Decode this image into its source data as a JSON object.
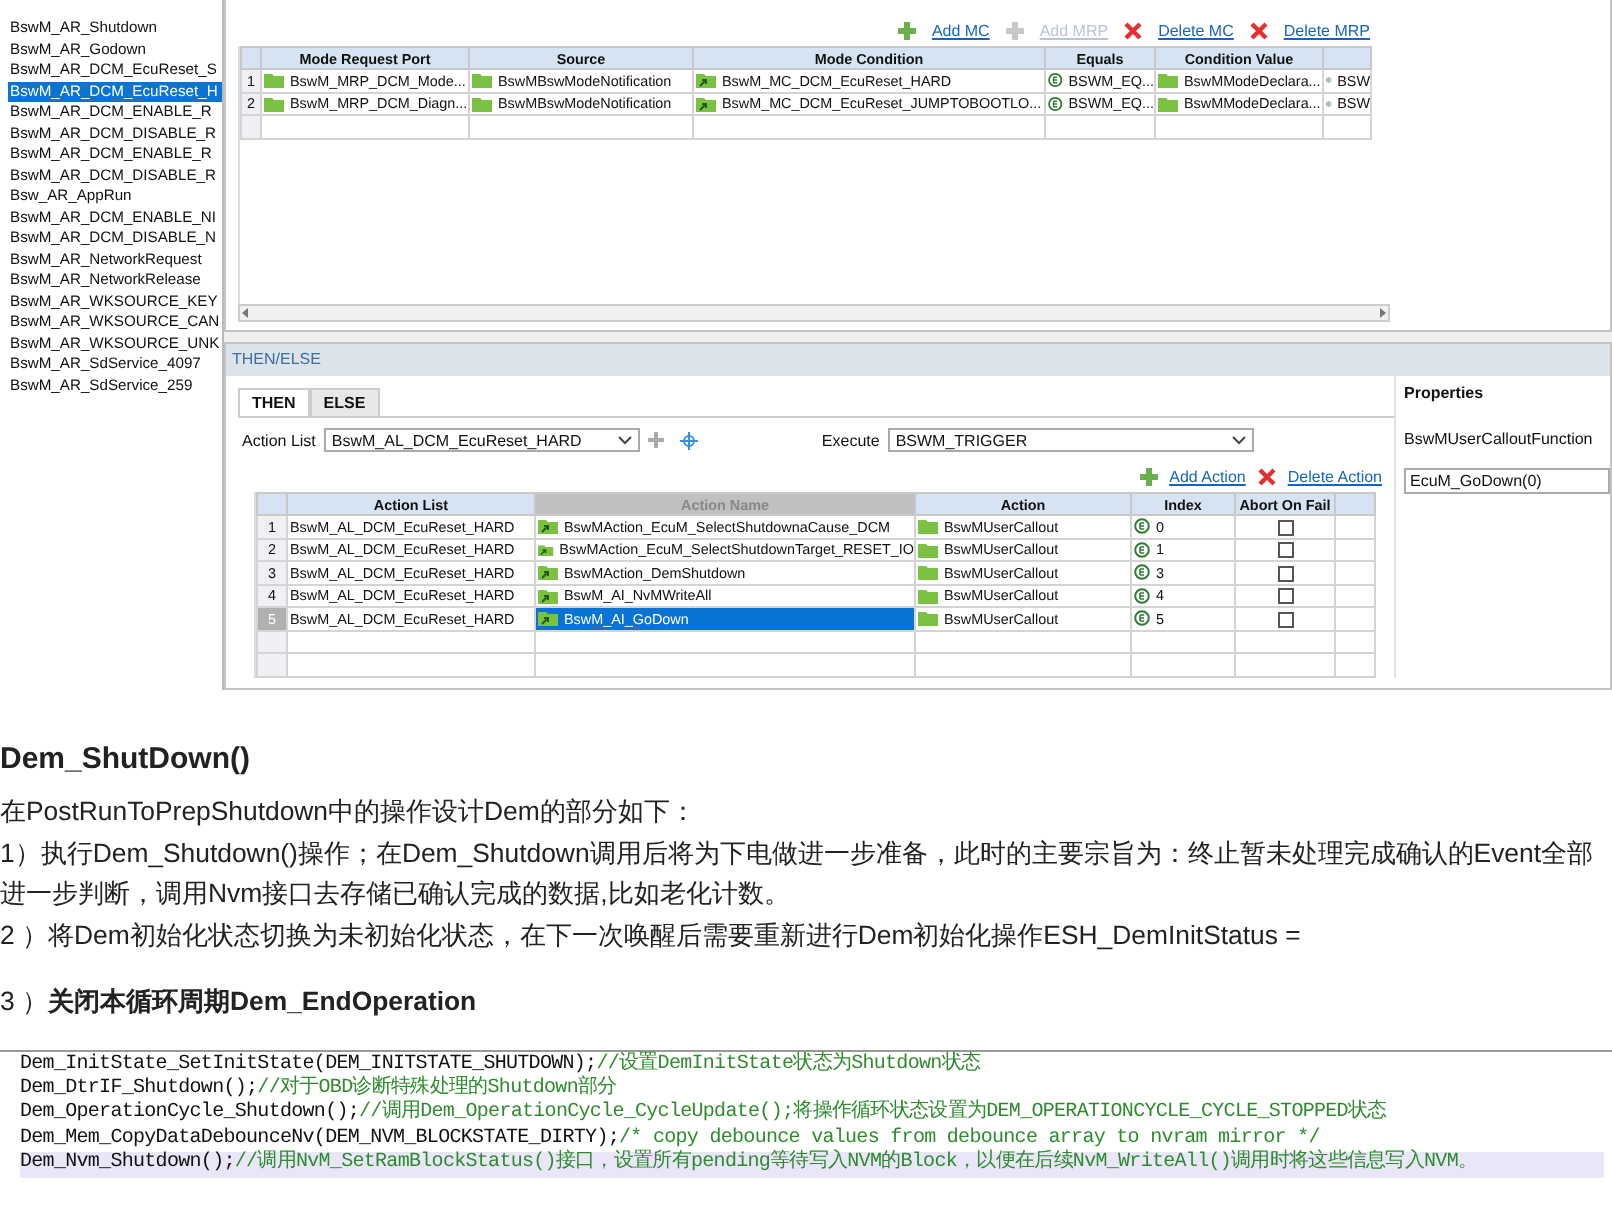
{
  "mode_list": {
    "items": [
      {
        "label": "BswM_AR_Shutdown",
        "selected": false
      },
      {
        "label": "BswM_AR_Godown",
        "selected": false
      },
      {
        "label": "BswM_AR_DCM_EcuReset_S",
        "selected": false
      },
      {
        "label": "BswM_AR_DCM_EcuReset_H",
        "selected": true
      },
      {
        "label": "BswM_AR_DCM_ENABLE_R",
        "selected": false
      },
      {
        "label": "BswM_AR_DCM_DISABLE_R",
        "selected": false
      },
      {
        "label": "BswM_AR_DCM_ENABLE_R",
        "selected": false
      },
      {
        "label": "BswM_AR_DCM_DISABLE_R",
        "selected": false
      },
      {
        "label": "Bsw_AR_AppRun",
        "selected": false
      },
      {
        "label": "BswM_AR_DCM_ENABLE_NI",
        "selected": false
      },
      {
        "label": "BswM_AR_DCM_DISABLE_N",
        "selected": false
      },
      {
        "label": "BswM_AR_NetworkRequest",
        "selected": false
      },
      {
        "label": "BswM_AR_NetworkRelease",
        "selected": false
      },
      {
        "label": "BswM_AR_WKSOURCE_KEY",
        "selected": false
      },
      {
        "label": "BswM_AR_WKSOURCE_CAN",
        "selected": false
      },
      {
        "label": "BswM_AR_WKSOURCE_UNK",
        "selected": false
      },
      {
        "label": "BswM_AR_SdService_4097",
        "selected": false
      },
      {
        "label": "BswM_AR_SdService_259",
        "selected": false
      }
    ]
  },
  "mode_toolbar": [
    {
      "kind": "add",
      "label": "Add MC",
      "disabled": false
    },
    {
      "kind": "add",
      "label": "Add MRP",
      "disabled": true
    },
    {
      "kind": "delete",
      "label": "Delete MC",
      "disabled": false
    },
    {
      "kind": "delete",
      "label": "Delete MRP",
      "disabled": false
    }
  ],
  "mode_table": {
    "columns": [
      "Mode Request Port",
      "Source",
      "Mode Condition",
      "Equals",
      "Condition Value"
    ],
    "rows": [
      {
        "number": "1",
        "cells": [
          {
            "kind": "folder",
            "text": "BswM_MRP_DCM_Mode..."
          },
          {
            "kind": "folder",
            "text": "BswMBswModeNotification"
          },
          {
            "kind": "link",
            "text": "BswM_MC_DCM_EcuReset_HARD"
          },
          {
            "kind": "enum",
            "text": "BSWM_EQ..."
          },
          {
            "kind": "folder",
            "text": "BswMModeDeclara..."
          },
          {
            "kind": "enum",
            "text": "BSW"
          }
        ]
      },
      {
        "number": "2",
        "cells": [
          {
            "kind": "folder",
            "text": "BswM_MRP_DCM_Diagn..."
          },
          {
            "kind": "folder",
            "text": "BswMBswModeNotification"
          },
          {
            "kind": "link",
            "text": "BswM_MC_DCM_EcuReset_JUMPTOBOOTLO..."
          },
          {
            "kind": "enum",
            "text": "BSWM_EQ..."
          },
          {
            "kind": "folder",
            "text": "BswMModeDeclara..."
          },
          {
            "kind": "enum",
            "text": "BSW"
          }
        ]
      }
    ]
  },
  "then_else": {
    "title": "THEN/ELSE",
    "tabs": [
      {
        "label": "THEN",
        "selected": true
      },
      {
        "label": "ELSE",
        "selected": false
      }
    ],
    "action_list": {
      "label": "Action List",
      "value": "BswM_AL_DCM_EcuReset_HARD"
    },
    "execute": {
      "label": "Execute",
      "value": "BSWM_TRIGGER"
    },
    "toolbar": [
      {
        "kind": "add",
        "label": "Add Action"
      },
      {
        "kind": "delete",
        "label": "Delete Action"
      }
    ],
    "table": {
      "columns": [
        {
          "label": "Action List",
          "sorted": false
        },
        {
          "label": "Action Name",
          "sorted": true
        },
        {
          "label": "Action",
          "sorted": false
        },
        {
          "label": "Index",
          "sorted": false
        },
        {
          "label": "Abort On Fail",
          "sorted": false
        }
      ],
      "rows": [
        {
          "number": "1",
          "action_list": "BswM_AL_DCM_EcuReset_HARD",
          "action_name": "BswMAction_EcuM_SelectShutdownaCause_DCM",
          "action": "BswMUserCallout",
          "index": "0",
          "abort_on_fail": false,
          "selected": false
        },
        {
          "number": "2",
          "action_list": "BswM_AL_DCM_EcuReset_HARD",
          "action_name": "BswMAction_EcuM_SelectShutdownTarget_RESET_IO",
          "action": "BswMUserCallout",
          "index": "1",
          "abort_on_fail": false,
          "selected": false
        },
        {
          "number": "3",
          "action_list": "BswM_AL_DCM_EcuReset_HARD",
          "action_name": "BswMAction_DemShutdown",
          "action": "BswMUserCallout",
          "index": "3",
          "abort_on_fail": false,
          "selected": false
        },
        {
          "number": "4",
          "action_list": "BswM_AL_DCM_EcuReset_HARD",
          "action_name": "BswM_AI_NvMWriteAll",
          "action": "BswMUserCallout",
          "index": "4",
          "abort_on_fail": false,
          "selected": false
        },
        {
          "number": "5",
          "action_list": "BswM_AL_DCM_EcuReset_HARD",
          "action_name": "BswM_AI_GoDown",
          "action": "BswMUserCallout",
          "index": "5",
          "abort_on_fail": false,
          "selected": true
        }
      ]
    },
    "properties": {
      "title": "Properties",
      "field_label": "BswMUserCalloutFunction",
      "value": "EcuM_GoDown(0)"
    }
  },
  "article": {
    "heading": "Dem_ShutDown()",
    "paragraphs": [
      "在PostRunToPrepShutdown中的操作设计Dem的部分如下：",
      "1）执行Dem_Shutdown()操作；在Dem_Shutdown调用后将为下电做进一步准备，此时的主要宗旨为：终止暂未处理完成确认的Event全部进一步判断，调用Nvm接口去存储已确认完成的数据,比如老化计数。",
      "2 ）将Dem初始化状态切换为未初始化状态，在下一次唤醒后需要重新进行Dem初始化操作ESH_DemInitStatus =",
      "3 ）**关闭本循环周期Dem_EndOperation**"
    ]
  },
  "code": {
    "lines": [
      {
        "code": "Dem_InitState_SetInitState(DEM_INITSTATE_SHUTDOWN);",
        "comment": "//设置DemInitState状态为Shutdown状态",
        "highlighted": false
      },
      {
        "code": "Dem_DtrIF_Shutdown();",
        "comment": "//对于OBD诊断特殊处理的Shutdown部分",
        "highlighted": false
      },
      {
        "code": "Dem_OperationCycle_Shutdown();",
        "comment": "//调用Dem_OperationCycle_CycleUpdate();将操作循环状态设置为DEM_OPERATIONCYCLE_CYCLE_STOPPED状态",
        "highlighted": false
      },
      {
        "code": "Dem_Mem_CopyDataDebounceNv(DEM_NVM_BLOCKSTATE_DIRTY);",
        "comment": "/* copy debounce values from debounce array to nvram mirror */",
        "highlighted": false
      },
      {
        "code": "Dem_Nvm_Shutdown();",
        "comment": "//调用NvM_SetRamBlockStatus()接口，设置所有pending等待写入NVM的Block，以便在后续NvM_WriteAll()调用时将这些信息写入NVM。",
        "highlighted": true
      }
    ]
  }
}
